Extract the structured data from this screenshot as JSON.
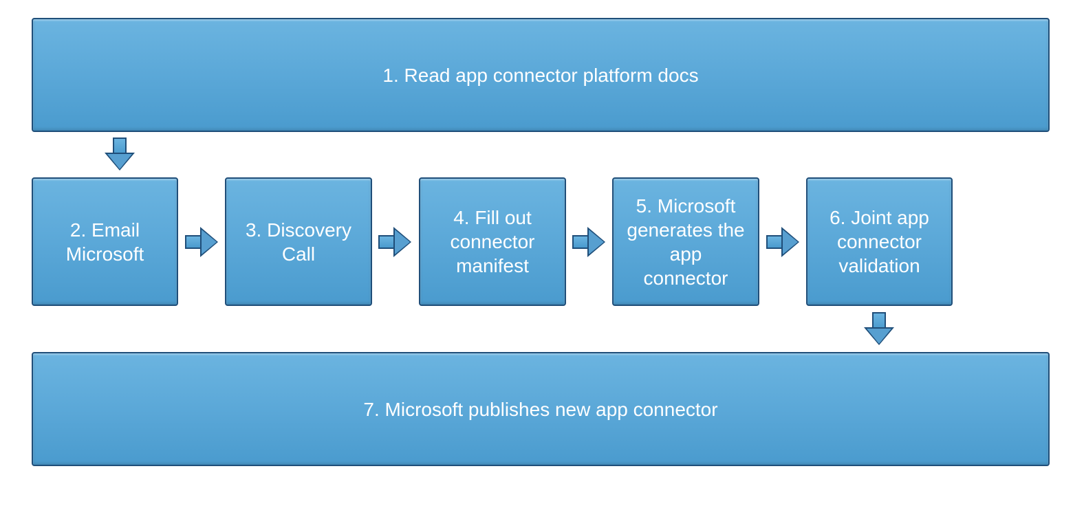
{
  "flow": {
    "steps": [
      {
        "id": "step1",
        "label": "1. Read app connector platform docs"
      },
      {
        "id": "step2",
        "label": "2. Email Microsoft"
      },
      {
        "id": "step3",
        "label": "3. Discovery Call"
      },
      {
        "id": "step4",
        "label": "4. Fill out connector manifest"
      },
      {
        "id": "step5",
        "label": "5. Microsoft generates the app connector"
      },
      {
        "id": "step6",
        "label": "6. Joint app connector validation"
      },
      {
        "id": "step7",
        "label": "7. Microsoft publishes new app connector"
      }
    ],
    "arrows": [
      {
        "from": "step1",
        "to": "step2",
        "direction": "down"
      },
      {
        "from": "step2",
        "to": "step3",
        "direction": "right"
      },
      {
        "from": "step3",
        "to": "step4",
        "direction": "right"
      },
      {
        "from": "step4",
        "to": "step5",
        "direction": "right"
      },
      {
        "from": "step5",
        "to": "step6",
        "direction": "right"
      },
      {
        "from": "step6",
        "to": "step7",
        "direction": "down"
      }
    ]
  },
  "colors": {
    "box_fill_top": "#6bb4e0",
    "box_fill_bottom": "#4a9bce",
    "border": "#1f4e79",
    "text": "#ffffff"
  }
}
